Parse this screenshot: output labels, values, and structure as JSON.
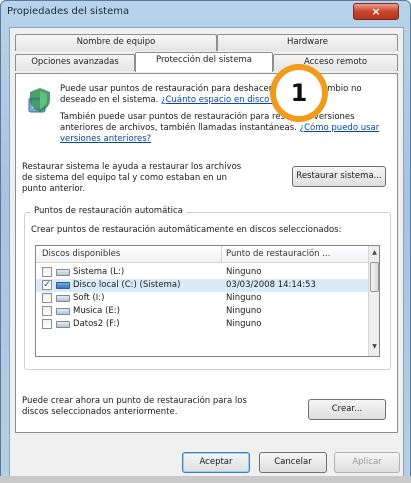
{
  "window": {
    "title": "Propiedades del sistema",
    "close_label": "×"
  },
  "tabs": [
    {
      "label": "Nombre de equipo"
    },
    {
      "label": "Hardware"
    },
    {
      "label": "Opciones avanzadas"
    },
    {
      "label": "Protección del sistema",
      "active": true
    },
    {
      "label": "Acceso remoto"
    }
  ],
  "intro": {
    "text1": "Puede usar puntos de restauración para deshacer cualquier cambio no deseado en el sistema.",
    "link1": "¿Cuánto espacio en disco se requiere?",
    "text2": "También puede usar puntos de restauración para restaurar versiones anteriores de archivos, también llamadas instantáneas.",
    "link2": "¿Cómo puedo usar versiones anteriores?"
  },
  "restore": {
    "description": "Restaurar sistema le ayuda a restaurar los archivos de sistema del equipo tal y como estaban en un punto anterior.",
    "button": "Restaurar sistema..."
  },
  "auto_restore": {
    "legend": "Puntos de restauración automática",
    "instruction": "Crear puntos de restauración automáticamente en discos seleccionados:",
    "columns": [
      "Discos disponibles",
      "Punto de restauración ..."
    ],
    "rows": [
      {
        "checked": false,
        "name": "Sistema (L:)",
        "point": "Ninguno",
        "system": false
      },
      {
        "checked": true,
        "name": "Disco local (C:) (Sistema)",
        "point": "03/03/2008 14:14:53",
        "system": true
      },
      {
        "checked": false,
        "name": "Soft (I:)",
        "point": "Ninguno",
        "system": false
      },
      {
        "checked": false,
        "name": "Musica (E:)",
        "point": "Ninguno",
        "system": false
      },
      {
        "checked": false,
        "name": "Datos2 (F:)",
        "point": "Ninguno",
        "system": false
      }
    ]
  },
  "create": {
    "description": "Puede crear ahora un punto de restauración para los discos seleccionados anteriormente.",
    "button": "Crear..."
  },
  "footer": {
    "ok": "Aceptar",
    "cancel": "Cancelar",
    "apply": "Aplicar"
  },
  "callout": {
    "number": "1",
    "color": "#f29a1a"
  },
  "colors": {
    "link": "#0645ad",
    "close": "#c8452b"
  }
}
